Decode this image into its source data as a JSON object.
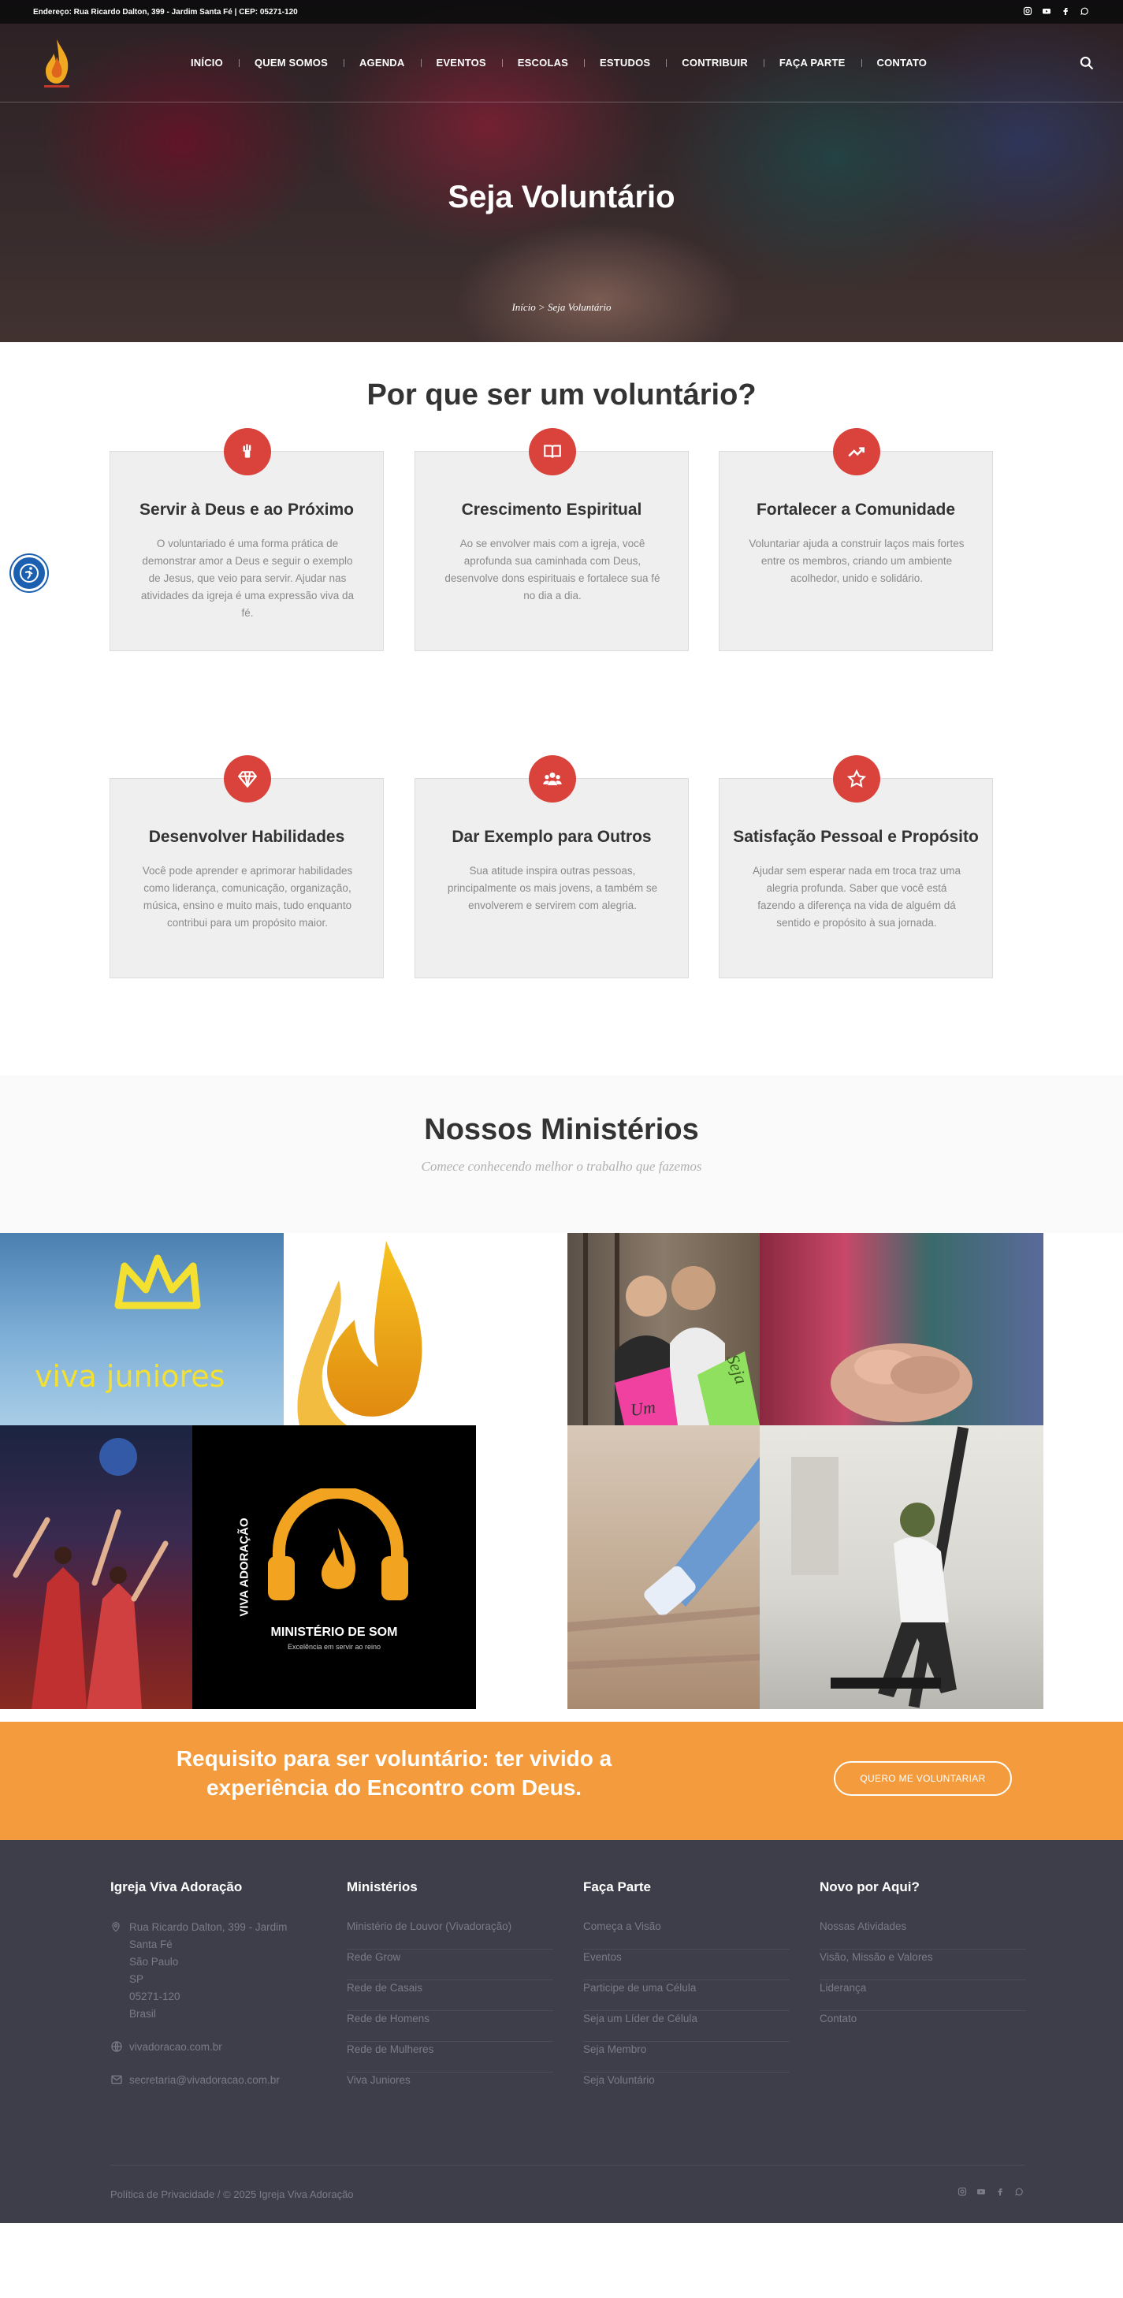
{
  "topbar": {
    "address": "Endereço: Rua Ricardo Dalton, 399 - Jardim Santa Fé | CEP: 05271-120",
    "social_icons": [
      "instagram-icon",
      "youtube-icon",
      "facebook-icon",
      "whatsapp-icon"
    ]
  },
  "nav": {
    "items": [
      {
        "label": "INÍCIO"
      },
      {
        "label": "QUEM SOMOS"
      },
      {
        "label": "AGENDA"
      },
      {
        "label": "EVENTOS"
      },
      {
        "label": "ESCOLAS"
      },
      {
        "label": "ESTUDOS"
      },
      {
        "label": "CONTRIBUIR"
      },
      {
        "label": "FAÇA PARTE"
      },
      {
        "label": "CONTATO"
      }
    ]
  },
  "hero": {
    "title": "Seja Voluntário",
    "breadcrumb": "Início > Seja Voluntário"
  },
  "why": {
    "title": "Por que ser um voluntário?",
    "cards": [
      {
        "icon": "hand-raised-icon",
        "title": "Servir à Deus e ao Próximo",
        "text": "O voluntariado é uma forma prática de demonstrar amor a Deus e seguir o exemplo de Jesus, que veio para servir. Ajudar nas atividades da igreja é uma expressão viva da fé."
      },
      {
        "icon": "book-icon",
        "title": "Crescimento Espiritual",
        "text": "Ao se envolver mais com a igreja, você aprofunda sua caminhada com Deus, desenvolve dons espirituais e fortalece sua fé no dia a dia."
      },
      {
        "icon": "trend-up-icon",
        "title": "Fortalecer a Comunidade",
        "text": "Voluntariar ajuda a construir laços mais fortes entre os membros, criando um ambiente acolhedor, unido e solidário."
      },
      {
        "icon": "diamond-icon",
        "title": "Desenvolver Habilidades",
        "text": "Você pode aprender e aprimorar habilidades como liderança, comunicação, organização, música, ensino e muito mais, tudo enquanto contribui para um propósito maior."
      },
      {
        "icon": "group-icon",
        "title": "Dar Exemplo para Outros",
        "text": "Sua atitude inspira outras pessoas, principalmente os mais jovens, a também se envolverem e servirem com alegria."
      },
      {
        "icon": "star-icon",
        "title": "Satisfação Pessoal e Propósito",
        "text": "Ajudar sem esperar nada em troca traz uma alegria profunda. Saber que você está fazendo a diferença na vida de alguém dá sentido e propósito à sua jornada."
      }
    ]
  },
  "ministries": {
    "title": "Nossos Ministérios",
    "subtitle": "Comece conhecendo melhor o trabalho que fazemos",
    "tiles": [
      {
        "caption": "viva juniores"
      },
      {
        "caption": "Um"
      },
      {
        "caption": "Seja"
      },
      {
        "caption_top": "VIVA ADORAÇÃO",
        "caption_main": "MINISTÉRIO DE SOM",
        "caption_sub": "Excelência em servir ao reino"
      }
    ]
  },
  "cta": {
    "text": "Requisito para ser voluntário: ter vivido a experiência do Encontro com Deus.",
    "button": "QUERO ME VOLUNTARIAR"
  },
  "footer": {
    "col1": {
      "title": "Igreja Viva Adoração",
      "address_lines": [
        "Rua Ricardo Dalton, 399 - Jardim",
        "Santa Fé",
        "São Paulo",
        "SP",
        "05271-120",
        "Brasil"
      ],
      "website": "vivadoracao.com.br",
      "email": "secretaria@vivadoracao.com.br"
    },
    "col2": {
      "title": "Ministérios",
      "links": [
        "Ministério de Louvor (Vivadoração)",
        "Rede Grow",
        "Rede de Casais",
        "Rede de Homens",
        "Rede de Mulheres",
        "Viva Juniores"
      ]
    },
    "col3": {
      "title": "Faça Parte",
      "links": [
        "Começa a Visão",
        "Eventos",
        "Participe de uma Célula",
        "Seja um Líder de Célula",
        "Seja Membro",
        "Seja Voluntário"
      ]
    },
    "col4": {
      "title": "Novo por Aqui?",
      "links": [
        "Nossas Atividades",
        "Visão, Missão e Valores",
        "Liderança",
        "Contato"
      ]
    },
    "copyright": "Política de Privacidade / © 2025 Igreja Viva Adoração"
  },
  "colors": {
    "accent_red": "#d9433c",
    "cta_orange": "#f39b3d",
    "footer_bg": "#3e3e4a",
    "a11y_blue": "#1b5fb0"
  }
}
